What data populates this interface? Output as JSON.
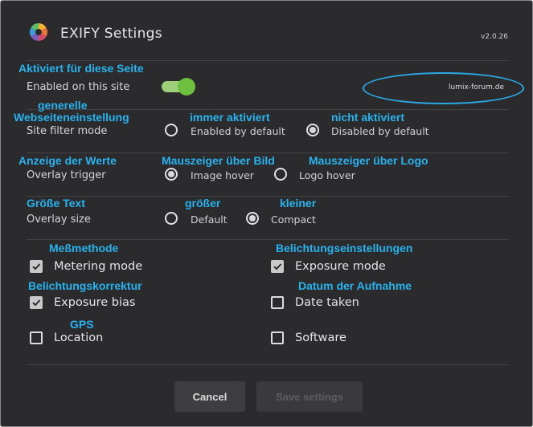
{
  "header": {
    "title": "EXIFY Settings",
    "version": "v2.0.26"
  },
  "annotations": {
    "enabled": "Aktiviert für diese Seite",
    "filter_line1": "generelle",
    "filter_line2": "Webseiteneinstellung",
    "enabled_default": "immer aktiviert",
    "disabled_default": "nicht aktiviert",
    "overlay_trigger": "Anzeige der Werte",
    "image_hover": "Mauszeiger über Bild",
    "logo_hover": "Mauszeiger über Logo",
    "overlay_size": "Größe Text",
    "size_default": "größer",
    "size_compact": "kleiner",
    "metering": "Meßmethode",
    "exposure_mode": "Belichtungseinstellungen",
    "exposure_bias": "Belichtungskorrektur",
    "date_taken": "Datum der Aufnahme",
    "location": "GPS"
  },
  "site": {
    "label": "Enabled on this site",
    "domain": "lumix-forum.de",
    "enabled": true
  },
  "filter_mode": {
    "label": "Site filter mode",
    "options": [
      "Enabled by default",
      "Disabled by default"
    ],
    "selected": "Disabled by default"
  },
  "overlay_trigger": {
    "label": "Overlay trigger",
    "options": [
      "Image hover",
      "Logo hover"
    ],
    "selected": "Image hover"
  },
  "overlay_size": {
    "label": "Overlay size",
    "options": [
      "Default",
      "Compact"
    ],
    "selected": "Compact"
  },
  "fields": {
    "metering_mode": {
      "label": "Metering mode",
      "checked": true
    },
    "exposure_mode": {
      "label": "Exposure mode",
      "checked": true
    },
    "exposure_bias": {
      "label": "Exposure bias",
      "checked": true
    },
    "date_taken": {
      "label": "Date taken",
      "checked": false
    },
    "location": {
      "label": "Location",
      "checked": false
    },
    "software": {
      "label": "Software",
      "checked": false
    }
  },
  "buttons": {
    "cancel": "Cancel",
    "save": "Save settings"
  },
  "colors": {
    "background": "#2b2b2d",
    "accent_green": "#6fbf3e",
    "annotation_blue": "#27b3ee"
  }
}
